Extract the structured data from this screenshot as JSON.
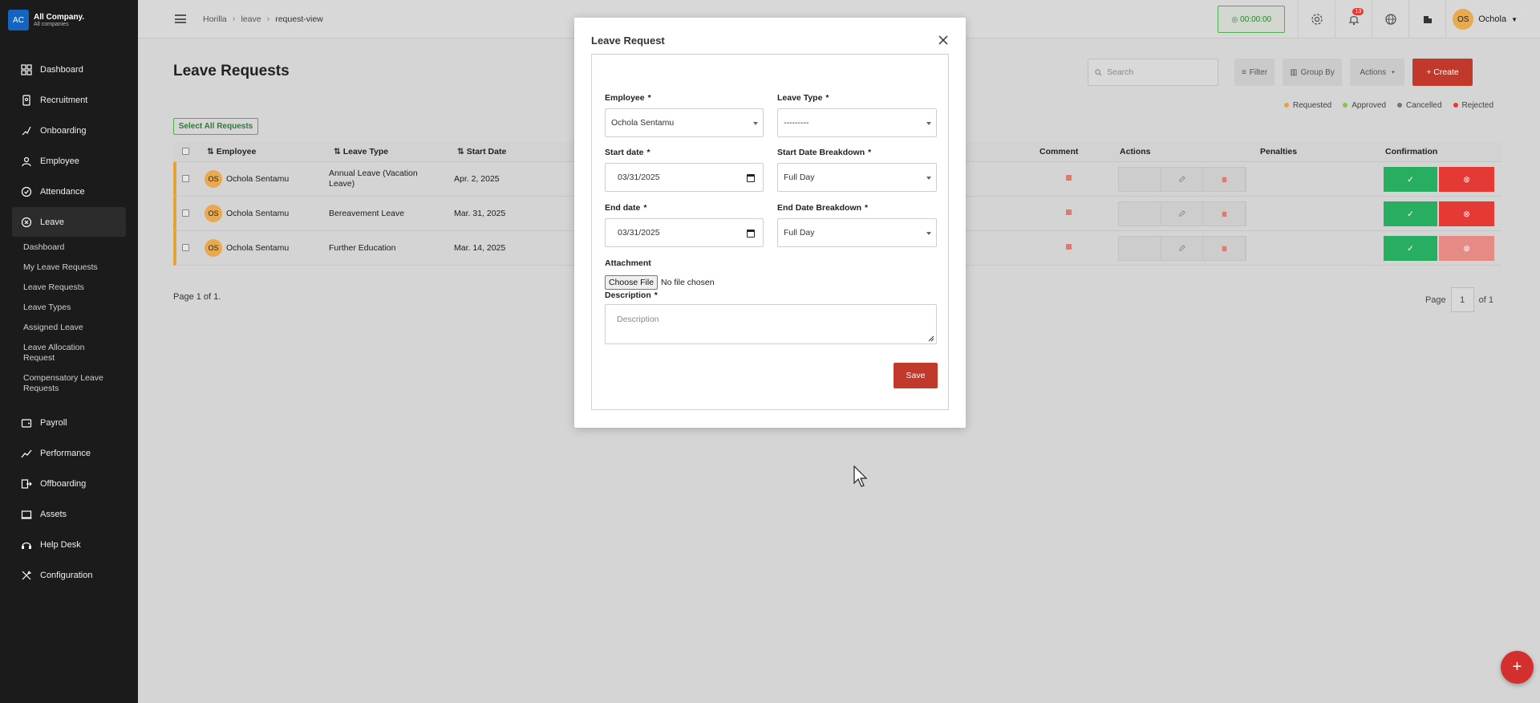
{
  "brand": {
    "logo": "AC",
    "name": "All Company.",
    "subtitle": "All companies"
  },
  "sidebar": {
    "items": [
      {
        "label": "Dashboard",
        "icon": "dashboard-icon"
      },
      {
        "label": "Recruitment",
        "icon": "recruitment-icon"
      },
      {
        "label": "Onboarding",
        "icon": "onboarding-icon"
      },
      {
        "label": "Employee",
        "icon": "employee-icon"
      },
      {
        "label": "Attendance",
        "icon": "attendance-icon"
      },
      {
        "label": "Leave",
        "icon": "leave-icon"
      },
      {
        "label": "Payroll",
        "icon": "payroll-icon"
      },
      {
        "label": "Performance",
        "icon": "performance-icon"
      },
      {
        "label": "Offboarding",
        "icon": "offboarding-icon"
      },
      {
        "label": "Assets",
        "icon": "assets-icon"
      },
      {
        "label": "Help Desk",
        "icon": "helpdesk-icon"
      },
      {
        "label": "Configuration",
        "icon": "configuration-icon"
      }
    ],
    "leave_sub": [
      "Dashboard",
      "My Leave Requests",
      "Leave Requests",
      "Leave Types",
      "Assigned Leave",
      "Leave Allocation Request",
      "Compensatory Leave Requests"
    ]
  },
  "header": {
    "breadcrumb": [
      "Horilla",
      "leave",
      "request-view"
    ],
    "timer": "00:00:00",
    "notifications": "13",
    "user_initials": "OS",
    "user_name": "Ochola"
  },
  "main": {
    "title": "Leave Requests",
    "search_placeholder": "Search",
    "filter": "Filter",
    "group_by": "Group By",
    "actions": "Actions",
    "create": "+ Create",
    "select_all": "Select All Requests",
    "legend": [
      {
        "label": "Requested",
        "color": "#e6a334"
      },
      {
        "label": "Approved",
        "color": "#8bc34a"
      },
      {
        "label": "Cancelled",
        "color": "#777777"
      },
      {
        "label": "Rejected",
        "color": "#e53935"
      }
    ],
    "columns": [
      "Employee",
      "Leave Type",
      "Start Date",
      "Comment",
      "Actions",
      "Penalties",
      "Confirmation"
    ],
    "rows": [
      {
        "initials": "OS",
        "employee": "Ochola Sentamu",
        "leave_type": "Annual Leave (Vacation Leave)",
        "start": "Apr. 2, 2025"
      },
      {
        "initials": "OS",
        "employee": "Ochola Sentamu",
        "leave_type": "Bereavement Leave",
        "start": "Mar. 31, 2025"
      },
      {
        "initials": "OS",
        "employee": "Ochola Sentamu",
        "leave_type": "Further Education",
        "start": "Mar. 14, 2025"
      }
    ],
    "page_info": "Page 1 of 1.",
    "pager": {
      "page_label": "Page",
      "page": "1",
      "of": "of 1"
    }
  },
  "modal": {
    "title": "Leave Request",
    "employee_label": "Employee",
    "employee_value": "Ochola Sentamu",
    "leave_type_label": "Leave Type",
    "leave_type_value": "---------",
    "start_date_label": "Start date",
    "start_date_value": "03/31/2025",
    "start_breakdown_label": "Start Date Breakdown",
    "start_breakdown_value": "Full Day",
    "end_date_label": "End date",
    "end_date_value": "03/31/2025",
    "end_breakdown_label": "End Date Breakdown",
    "end_breakdown_value": "Full Day",
    "attachment_label": "Attachment",
    "choose_file": "Choose File",
    "no_file": "No file chosen",
    "description_label": "Description",
    "description_placeholder": "Description",
    "save": "Save",
    "required_mark": "*"
  }
}
